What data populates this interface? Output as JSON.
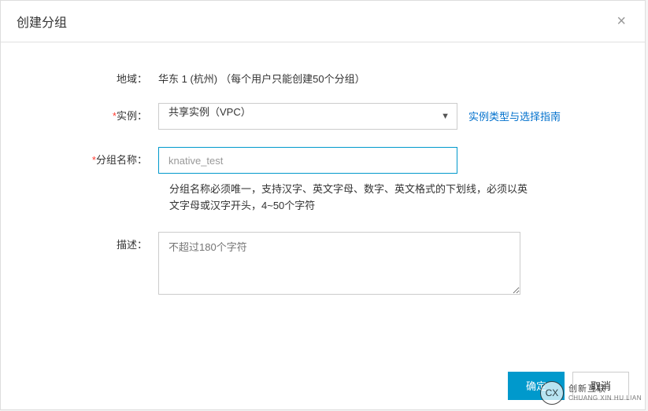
{
  "dialog": {
    "title": "创建分组",
    "close_icon": "×"
  },
  "form": {
    "region": {
      "label": "地域：",
      "value": "华东 1 (杭州)",
      "hint": "（每个用户只能创建50个分组）"
    },
    "instance": {
      "label": "实例：",
      "selected": "共享实例（VPC）",
      "link_text": "实例类型与选择指南"
    },
    "group_name": {
      "label": "分组名称：",
      "value": "knative_test",
      "help": "分组名称必须唯一，支持汉字、英文字母、数字、英文格式的下划线，必须以英文字母或汉字开头，4~50个字符"
    },
    "description": {
      "label": "描述：",
      "placeholder": "不超过180个字符"
    }
  },
  "footer": {
    "confirm": "确定",
    "cancel": "取消"
  },
  "watermark": {
    "brand": "创新互联",
    "sub": "CHUANG XIN HU LIAN",
    "logo": "CX"
  }
}
